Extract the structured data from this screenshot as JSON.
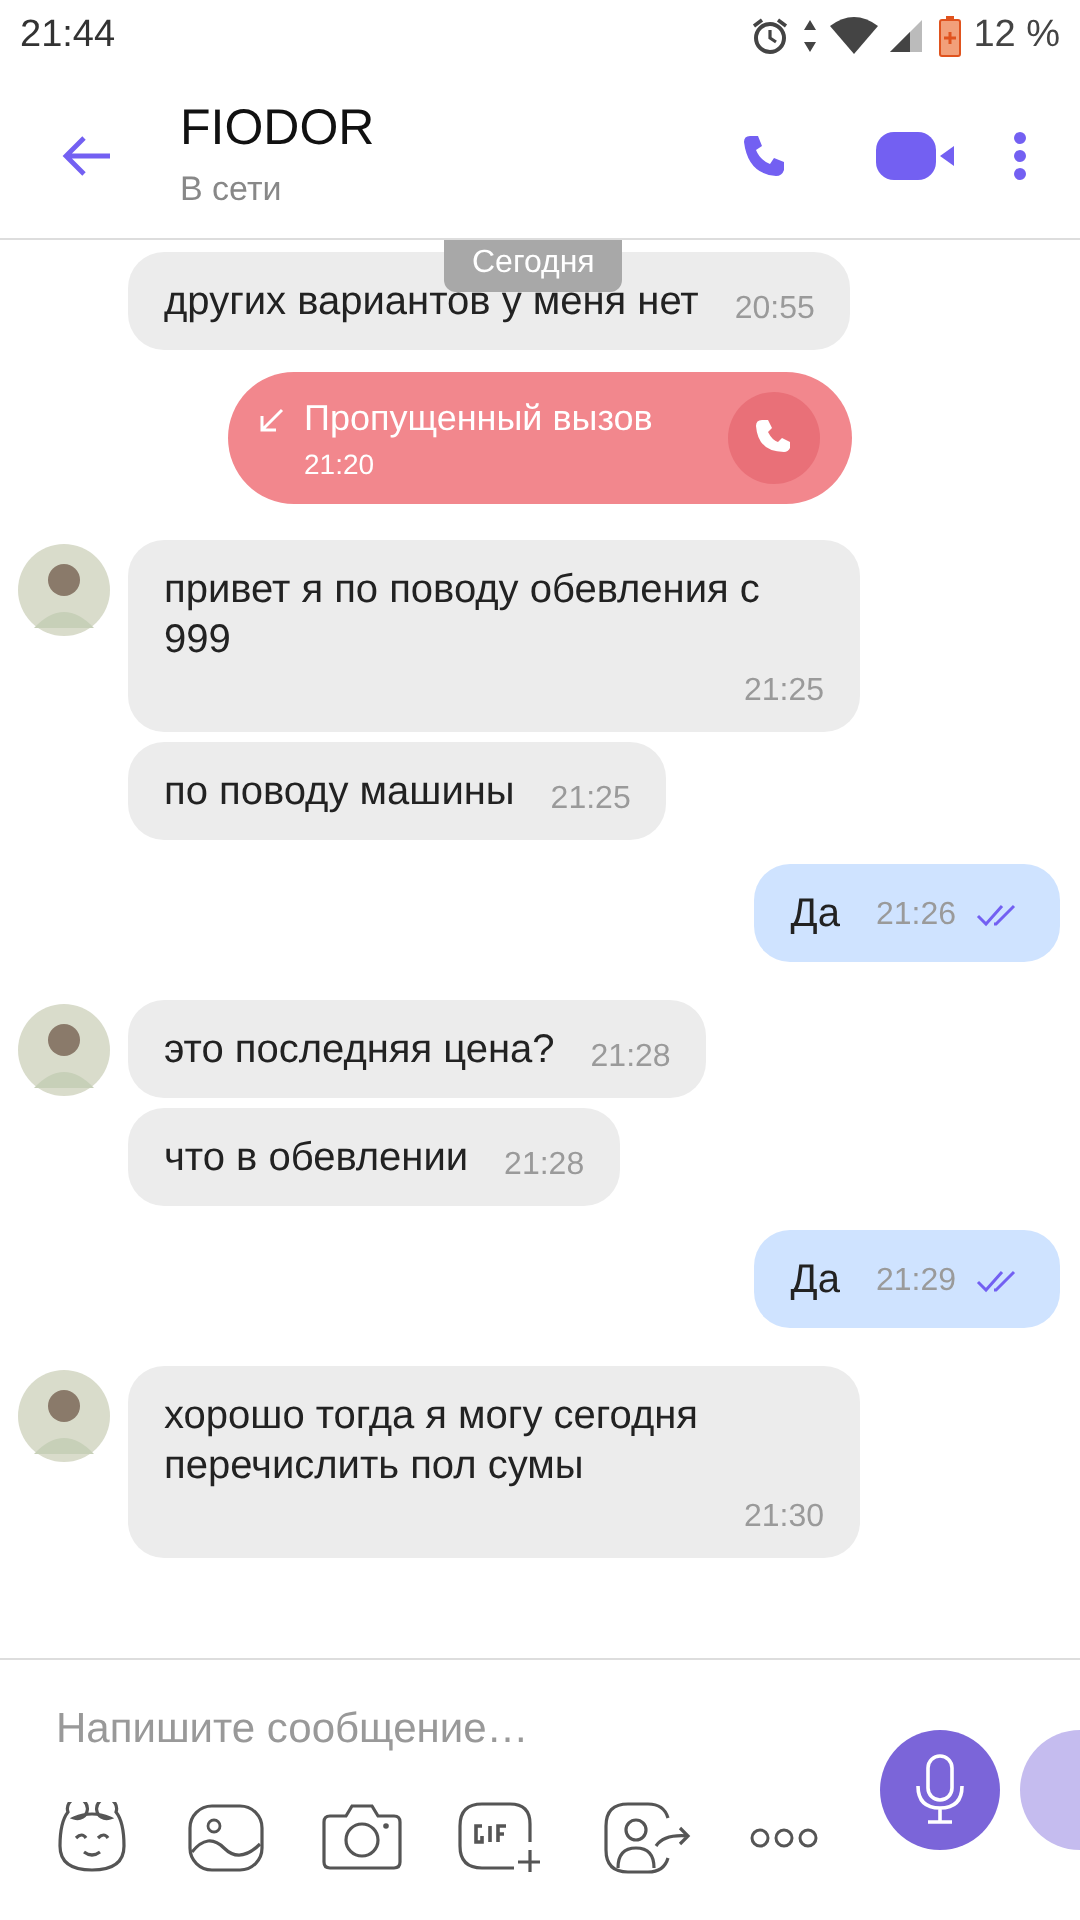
{
  "status_bar": {
    "time": "21:44",
    "battery": "12 %"
  },
  "header": {
    "name": "FIODOR",
    "status": "В сети"
  },
  "date_chip": "Сегодня",
  "messages": [
    {
      "kind": "in",
      "avatar": false,
      "text": "других вариантов у меня нет",
      "time": "20:55"
    },
    {
      "kind": "missed_call",
      "text": "Пропущенный вызов",
      "time": "21:20"
    },
    {
      "kind": "in",
      "avatar": true,
      "text": "привет я по поводу обевления  с 999",
      "time": "21:25"
    },
    {
      "kind": "in",
      "avatar": false,
      "text": "по поводу машины",
      "time": "21:25"
    },
    {
      "kind": "out",
      "text": "Да",
      "time": "21:26",
      "read": true
    },
    {
      "kind": "in",
      "avatar": true,
      "text": "это последняя цена?",
      "time": "21:28"
    },
    {
      "kind": "in",
      "avatar": false,
      "text": "что в обевлении",
      "time": "21:28"
    },
    {
      "kind": "out",
      "text": "Да",
      "time": "21:29",
      "read": true
    },
    {
      "kind": "in",
      "avatar": true,
      "text": "хорошо тогда я могу сегодня перечислить пол сумы",
      "time": "21:30"
    }
  ],
  "composer": {
    "placeholder": "Напишите сообщение…"
  }
}
